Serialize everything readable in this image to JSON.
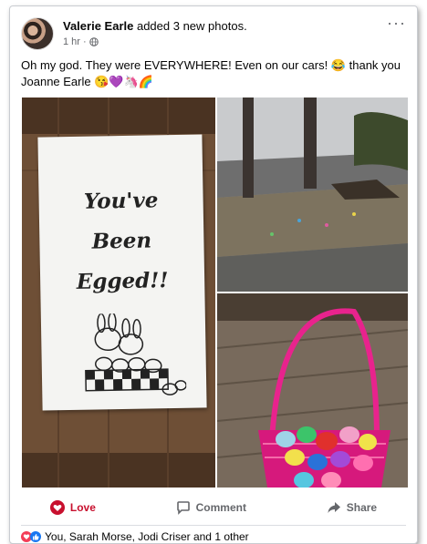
{
  "post": {
    "author": "Valerie Earle",
    "action": "added 3 new photos.",
    "time": "1 hr",
    "separator": "·",
    "text_line1": "Oh my god. They were EVERYWHERE! Even on our cars! 😂 thank you",
    "text_line2": "Joanne Earle 😘💜🦄🌈",
    "more": "···"
  },
  "photos": {
    "sign_line1": "You've",
    "sign_line2": "Been",
    "sign_line3": "Egged!!"
  },
  "actions": {
    "love": "Love",
    "comment": "Comment",
    "share": "Share"
  },
  "reactions": {
    "summary": "You, Sarah Morse, Jodi Criser and 1 other"
  },
  "colors": {
    "love": "#c8102e",
    "like": "#1877f2",
    "heart": "#f33e58"
  }
}
